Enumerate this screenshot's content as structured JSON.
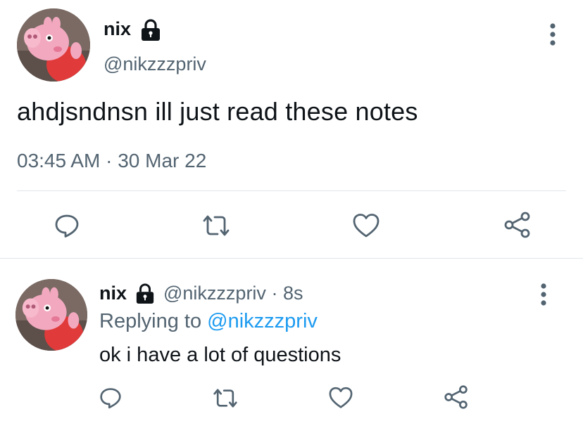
{
  "main_tweet": {
    "display_name": "nix",
    "handle": "@nikzzzpriv",
    "text": "ahdjsndnsn ill just read these notes",
    "time": "03:45 AM",
    "separator": "·",
    "date": "30 Mar 22",
    "actions": [
      "reply-icon",
      "retweet-icon",
      "like-icon",
      "share-icon"
    ]
  },
  "reply_tweet": {
    "display_name": "nix",
    "handle": "@nikzzzpriv",
    "separator": "·",
    "age": "8s",
    "replying_label": "Replying to",
    "replying_handle": "@nikzzzpriv",
    "text": "ok i have a lot of questions",
    "actions": [
      "reply-icon",
      "retweet-icon",
      "like-icon",
      "share-icon"
    ]
  },
  "colors": {
    "text": "#0f1419",
    "secondary": "#536471",
    "link": "#1d9bf0",
    "divider": "#e1e6ea"
  }
}
